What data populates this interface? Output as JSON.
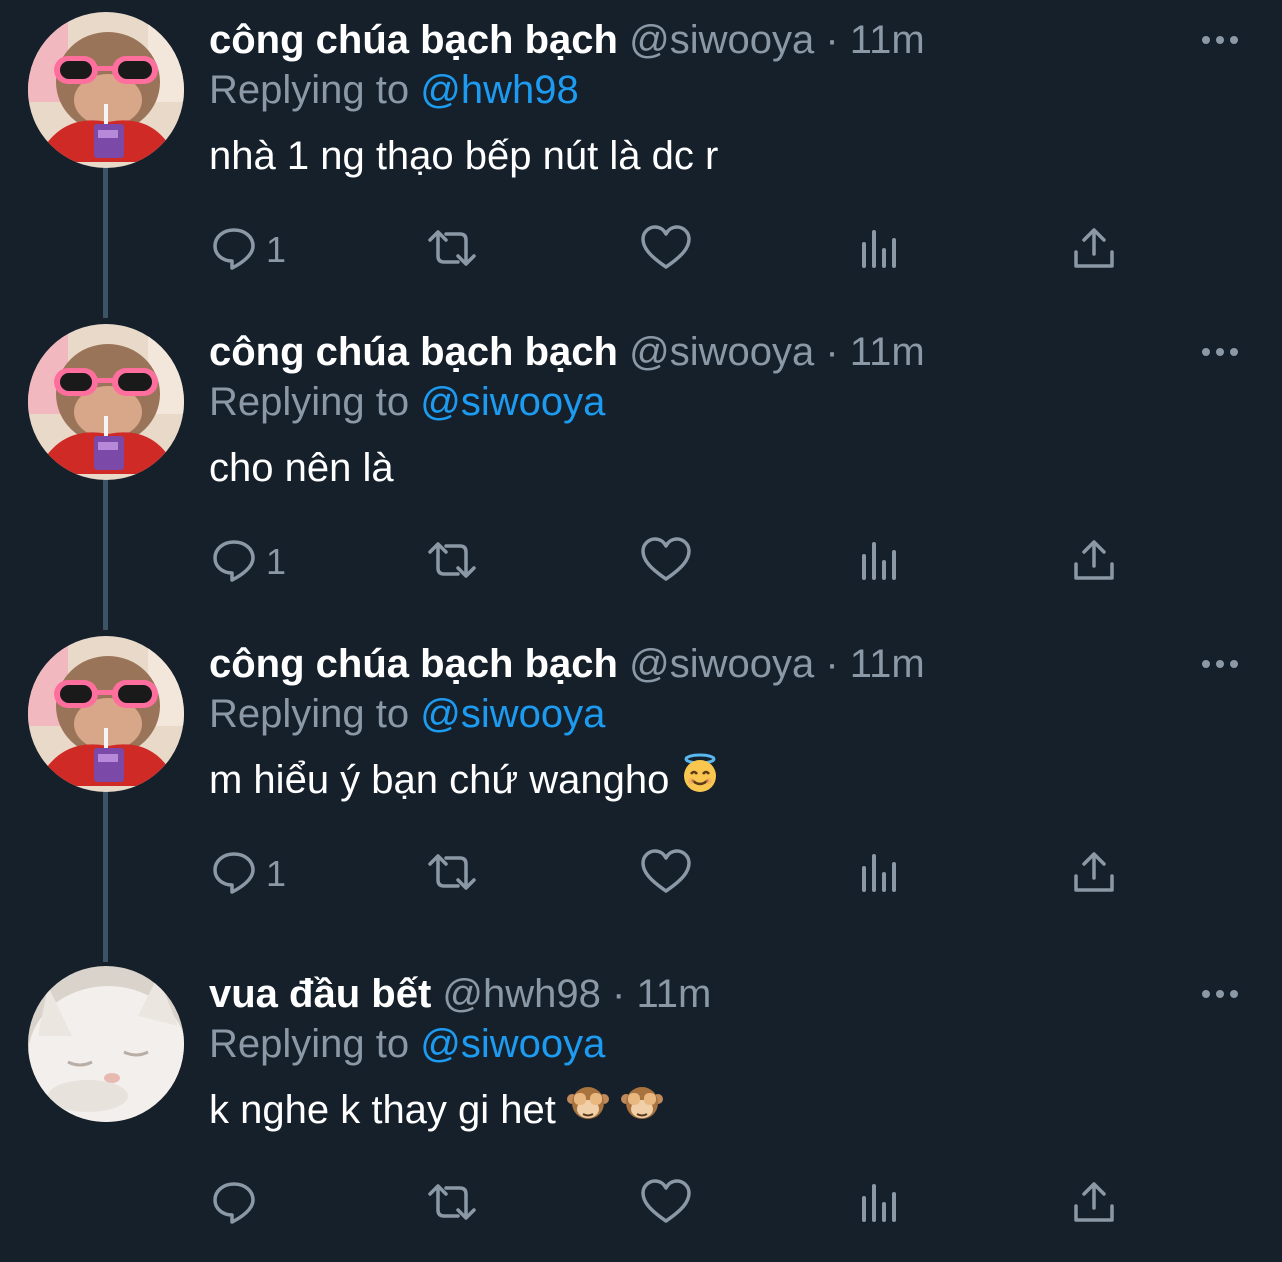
{
  "tweets": [
    {
      "name": "công chúa bạch bạch",
      "handle": "@siwooya",
      "dot": "·",
      "time": "11m",
      "replying_prefix": "Replying to",
      "replying_to": "@hwh98",
      "text": "nhà 1 ng thạo bếp nút là dc r",
      "emojis": [],
      "reply_count": "1",
      "avatar": "monkey-sunglasses"
    },
    {
      "name": "công chúa bạch bạch",
      "handle": "@siwooya",
      "dot": "·",
      "time": "11m",
      "replying_prefix": "Replying to",
      "replying_to": "@siwooya",
      "text": "cho nên là",
      "emojis": [],
      "reply_count": "1",
      "avatar": "monkey-sunglasses"
    },
    {
      "name": "công chúa bạch bạch",
      "handle": "@siwooya",
      "dot": "·",
      "time": "11m",
      "replying_prefix": "Replying to",
      "replying_to": "@siwooya",
      "text": "m hiểu ý bạn chứ wangho",
      "emojis": [
        "smiling-face-with-halo"
      ],
      "reply_count": "1",
      "avatar": "monkey-sunglasses"
    },
    {
      "name": "vua đầu bết",
      "handle": "@hwh98",
      "dot": "·",
      "time": "11m",
      "replying_prefix": "Replying to",
      "replying_to": "@siwooya",
      "text": "k nghe k thay gi het",
      "emojis": [
        "see-no-evil-monkey",
        "see-no-evil-monkey"
      ],
      "reply_count": "",
      "avatar": "white-cat"
    }
  ],
  "colors": {
    "background": "#15202b",
    "text_primary": "#ffffff",
    "text_secondary": "#8b98a5",
    "link": "#1d9bf0",
    "thread_line": "#3d5466"
  },
  "icons": {
    "reply": "reply-icon",
    "retweet": "retweet-icon",
    "like": "heart-icon",
    "views": "views-icon",
    "share": "share-icon",
    "more": "more-icon"
  }
}
